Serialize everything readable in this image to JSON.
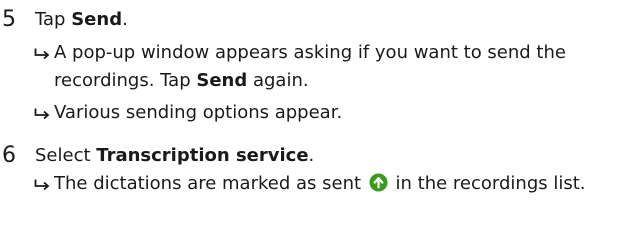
{
  "step5": {
    "number": "5",
    "text_before": "Tap ",
    "bold": "Send",
    "text_after": ".",
    "results": [
      {
        "part1": "A pop-up window appears asking if you want to send the recordings. Tap ",
        "bold": "Send",
        "part2": " again."
      },
      {
        "text": "Various sending options appear."
      }
    ]
  },
  "step6": {
    "number": "6",
    "text_before": "Select ",
    "bold": "Transcription service",
    "text_after": ".",
    "results": [
      {
        "part1": "The dictations are marked as sent",
        "icon": "sent-upload-icon",
        "part2": "in the recordings list."
      }
    ]
  },
  "colors": {
    "text": "#1a1a1a",
    "sent_icon": "#3a9b1e"
  }
}
